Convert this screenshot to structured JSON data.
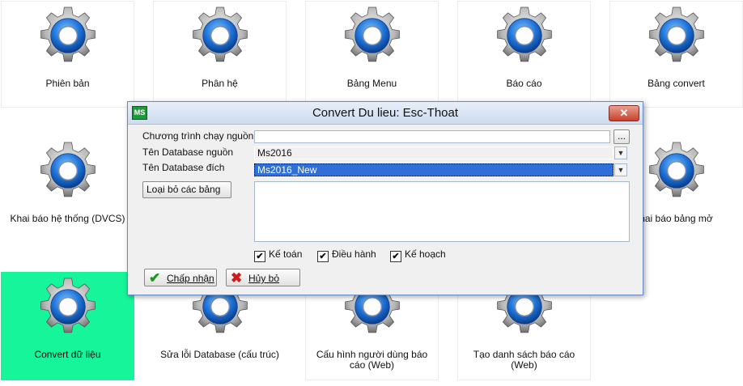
{
  "tiles": [
    {
      "label": "Phiên bản"
    },
    {
      "label": "Phân hệ"
    },
    {
      "label": "Bảng Menu"
    },
    {
      "label": "Báo cáo"
    },
    {
      "label": "Bảng convert"
    },
    {
      "label": "Khai báo hệ thống (DVCS)"
    },
    {
      "label": "hai báo bảng mở"
    },
    {
      "label": "Convert dữ liệu"
    },
    {
      "label": "Sửa lỗi Database (cấu trúc)"
    },
    {
      "label": "Cấu hình người dùng báo cáo (Web)"
    },
    {
      "label": "Tạo danh sách báo cáo (Web)"
    }
  ],
  "dialog": {
    "title": "Convert Du lieu: Esc-Thoat",
    "logo": "MS",
    "close": "✕",
    "source_program_label": "Chương trình chạy nguồn",
    "source_program_value": "",
    "browse_label": "...",
    "source_db_label": "Tên Database nguồn",
    "source_db_value": "Ms2016",
    "target_db_label": "Tên Database đích",
    "target_db_value": "Ms2016_New",
    "exclude_tables_label": "Loại bỏ các bảng",
    "checkboxes": [
      {
        "label": "Kế toán",
        "checked": true
      },
      {
        "label": "Điều hành",
        "checked": true
      },
      {
        "label": "Kế hoạch",
        "checked": true
      }
    ],
    "accept_label": "Chấp nhận",
    "cancel_label": "Hủy bỏ"
  },
  "colors": {
    "selected_tile": "#16f59a",
    "selection": "#2f6fd6",
    "accept_icon": "#1a9a1a",
    "cancel_icon": "#d21a1a"
  }
}
